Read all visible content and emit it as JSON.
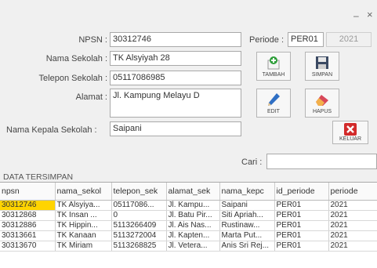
{
  "window": {
    "minimize": "–",
    "close": "×"
  },
  "form": {
    "npsn_label": "NPSN :",
    "npsn_value": "30312746",
    "nama_sekolah_label": "Nama Sekolah :",
    "nama_sekolah_value": "TK Alsyiyah 28",
    "telepon_label": "Telepon Sekolah :",
    "telepon_value": "05117086985",
    "alamat_label": "Alamat :",
    "alamat_value": "Jl. Kampung Melayu D",
    "kepala_label": "Nama Kepala Sekolah :",
    "kepala_value": "Saipani",
    "periode_label": "Periode :",
    "periode_value": "PER01",
    "periode_year": "2021",
    "cari_label": "Cari :",
    "cari_value": ""
  },
  "buttons": {
    "tambah": "TAMBAH",
    "simpan": "SIMPAN",
    "edit": "EDIT",
    "hapus": "HAPUS",
    "keluar": "KELUAR"
  },
  "section_title": "DATA TERSIMPAN",
  "table": {
    "headers": [
      "npsn",
      "nama_sekol",
      "telepon_sek",
      "alamat_sek",
      "nama_kepc",
      "id_periode",
      "periode"
    ],
    "rows": [
      [
        "30312746",
        "TK Alsyiya...",
        "05117086...",
        "Jl. Kampu...",
        "Saipani",
        "PER01",
        "2021"
      ],
      [
        "30312868",
        "TK Insan ...",
        "0",
        "Jl. Batu Pir...",
        "Siti Apriah...",
        "PER01",
        "2021"
      ],
      [
        "30312886",
        "TK Hippin...",
        "5113266409",
        "Jl. Ais Nas...",
        "Rustinaw...",
        "PER01",
        "2021"
      ],
      [
        "30313661",
        "TK Kanaan",
        "5113272004",
        "Jl. Kapten...",
        "Marta Put...",
        "PER01",
        "2021"
      ],
      [
        "30313670",
        "TK Miriam",
        "5113268825",
        "Jl. Vetera...",
        "Anis Sri Rej...",
        "PER01",
        "2021"
      ]
    ]
  },
  "colors": {
    "selected_cell": "#ffd400",
    "tambah_icon": "#2e9e3a",
    "keluar_icon": "#d22a2a"
  }
}
